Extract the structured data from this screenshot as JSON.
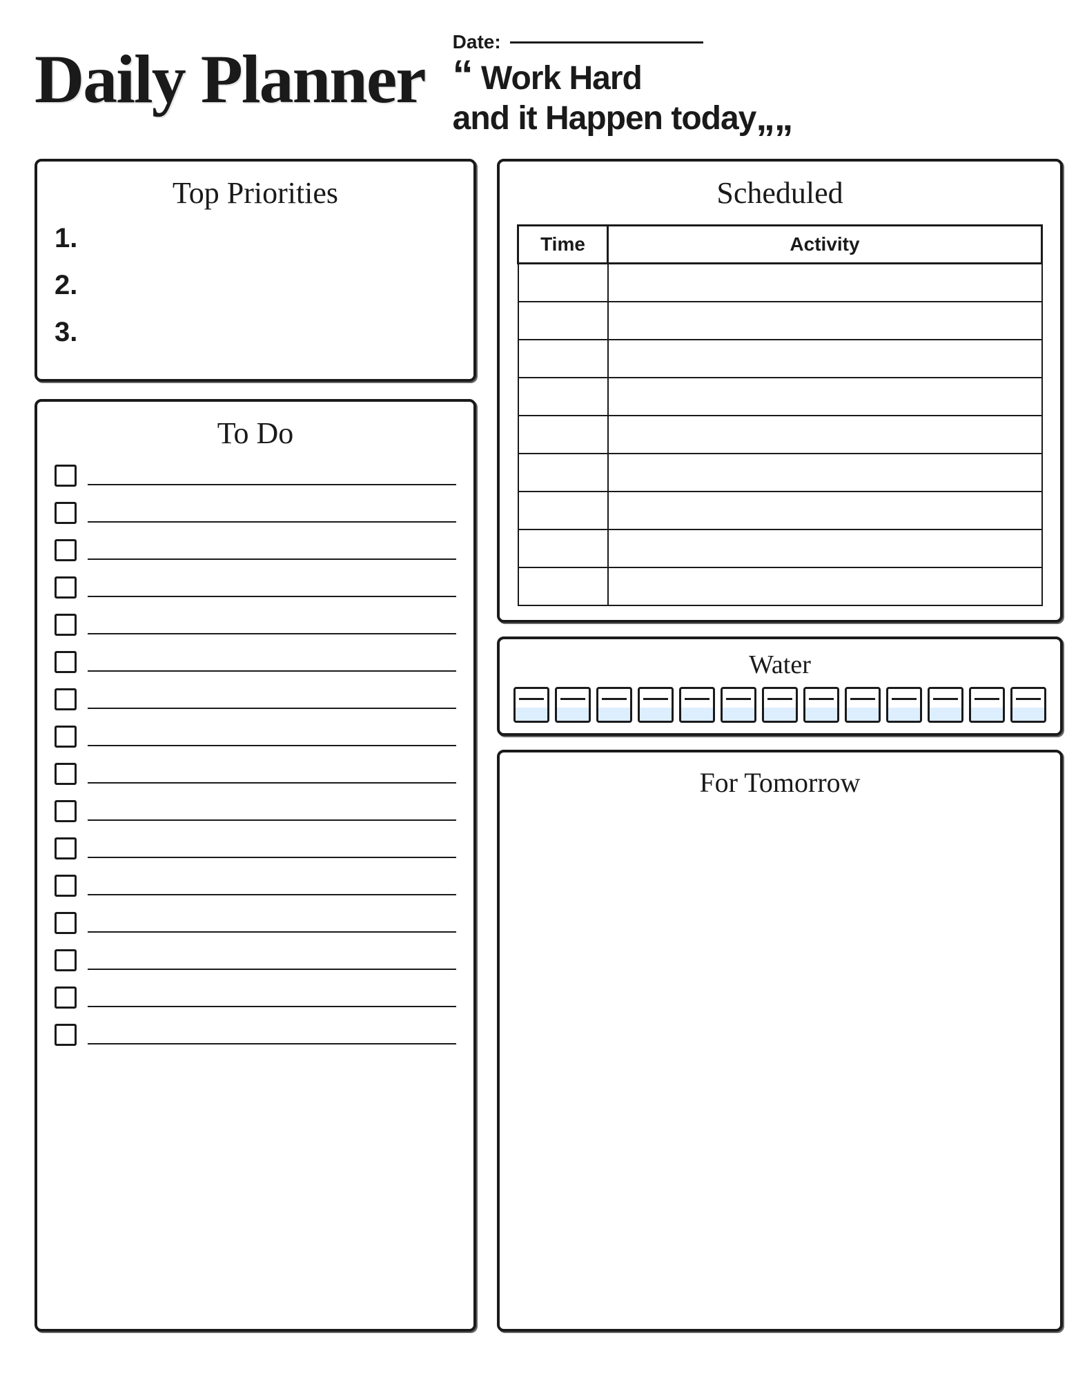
{
  "header": {
    "title": "Daily Planner",
    "date_label": "Date:",
    "quote_open": "“",
    "quote_line1": "Work Hard",
    "quote_line2": "and it Happen today",
    "quote_close": "””"
  },
  "top_priorities": {
    "section_title": "Top Priorities",
    "items": [
      {
        "number": "1."
      },
      {
        "number": "2."
      },
      {
        "number": "3."
      }
    ]
  },
  "todo": {
    "section_title": "To Do",
    "items": [
      {},
      {},
      {},
      {},
      {},
      {},
      {},
      {},
      {},
      {},
      {},
      {},
      {},
      {},
      {},
      {}
    ]
  },
  "scheduled": {
    "section_title": "Scheduled",
    "col_time": "Time",
    "col_activity": "Activity",
    "rows": [
      {},
      {},
      {},
      {},
      {},
      {},
      {},
      {},
      {}
    ]
  },
  "water": {
    "title": "Water",
    "glasses_count": 13
  },
  "tomorrow": {
    "title": "For Tomorrow"
  }
}
